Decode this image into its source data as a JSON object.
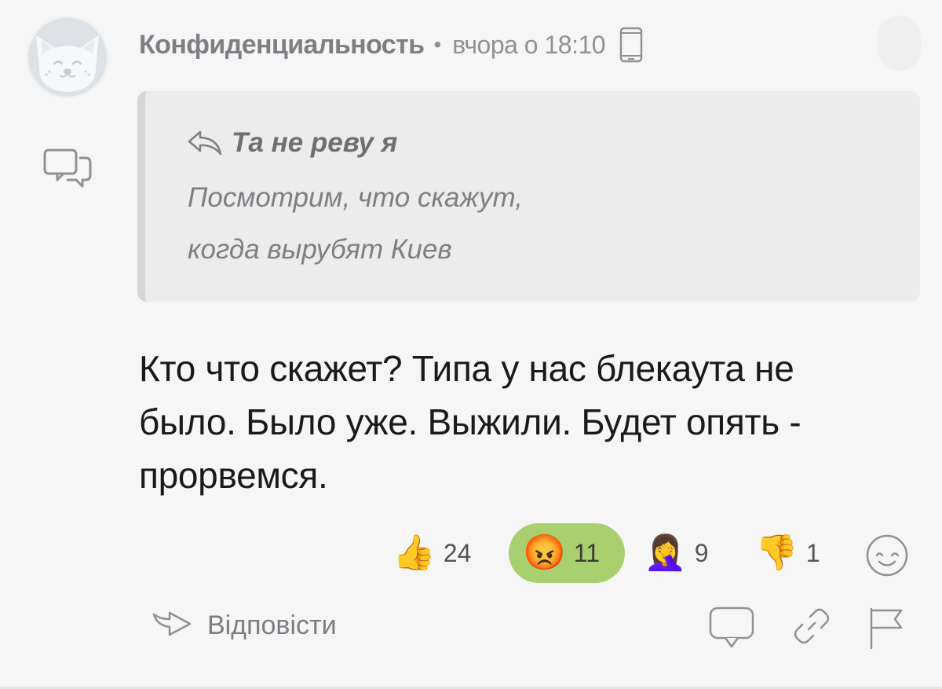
{
  "comment": {
    "author": "Конфиденциальность",
    "separator": "•",
    "timestamp": "вчора о 18:10",
    "device_icon": "phone-icon",
    "quote": {
      "author": "Та не реву я",
      "lines": [
        "Посмотрим, что скажут,",
        "когда вырубят Киев"
      ]
    },
    "body": "Кто что скажет? Типа у нас блекаута не было. Было уже. Выжили. Будет опять - прорвемся."
  },
  "reactions": [
    {
      "emoji": "👍",
      "name": "thumbs-up",
      "count": "24",
      "active": false
    },
    {
      "emoji": "😡",
      "name": "angry-face",
      "count": "11",
      "active": true
    },
    {
      "emoji": "🤦‍♀️",
      "name": "facepalm",
      "count": "9",
      "active": false
    },
    {
      "emoji": "👎",
      "name": "thumbs-down",
      "count": "1",
      "active": false
    }
  ],
  "actions": {
    "reply_label": "Відповісти",
    "icons": [
      "comment-icon",
      "link-icon",
      "flag-icon"
    ]
  },
  "colors": {
    "background": "#f6f6f6",
    "active_reaction": "#a9cf6e",
    "quote_background": "#ececec",
    "muted_text": "#7c7f84"
  }
}
